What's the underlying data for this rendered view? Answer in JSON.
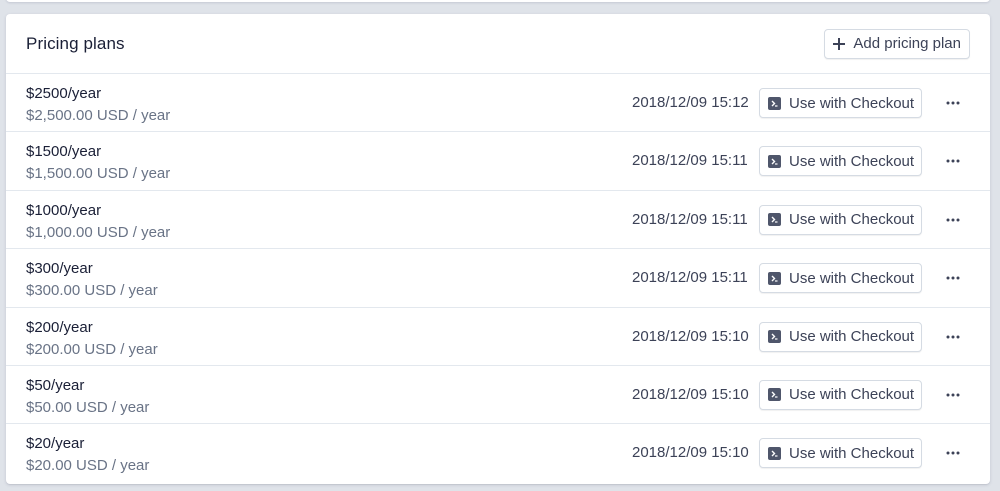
{
  "section": {
    "title": "Pricing plans",
    "add_button_label": "Add pricing plan"
  },
  "plans": [
    {
      "name": "$2500/year",
      "price": "$2,500.00 USD / year",
      "created": "2018/12/09 15:12",
      "action": "Use with Checkout"
    },
    {
      "name": "$1500/year",
      "price": "$1,500.00 USD / year",
      "created": "2018/12/09 15:11",
      "action": "Use with Checkout"
    },
    {
      "name": "$1000/year",
      "price": "$1,000.00 USD / year",
      "created": "2018/12/09 15:11",
      "action": "Use with Checkout"
    },
    {
      "name": "$300/year",
      "price": "$300.00 USD / year",
      "created": "2018/12/09 15:11",
      "action": "Use with Checkout"
    },
    {
      "name": "$200/year",
      "price": "$200.00 USD / year",
      "created": "2018/12/09 15:10",
      "action": "Use with Checkout"
    },
    {
      "name": "$50/year",
      "price": "$50.00 USD / year",
      "created": "2018/12/09 15:10",
      "action": "Use with Checkout"
    },
    {
      "name": "$20/year",
      "price": "$20.00 USD / year",
      "created": "2018/12/09 15:10",
      "action": "Use with Checkout"
    }
  ],
  "icons": {
    "add": "plus-icon",
    "checkout": "terminal-icon",
    "more": "more-horizontal-icon"
  },
  "colors": {
    "background": "#dfe3e9",
    "card": "#ffffff",
    "text_primary": "#1a1f36",
    "text_secondary": "#697386",
    "border": "#e3e8ee"
  }
}
